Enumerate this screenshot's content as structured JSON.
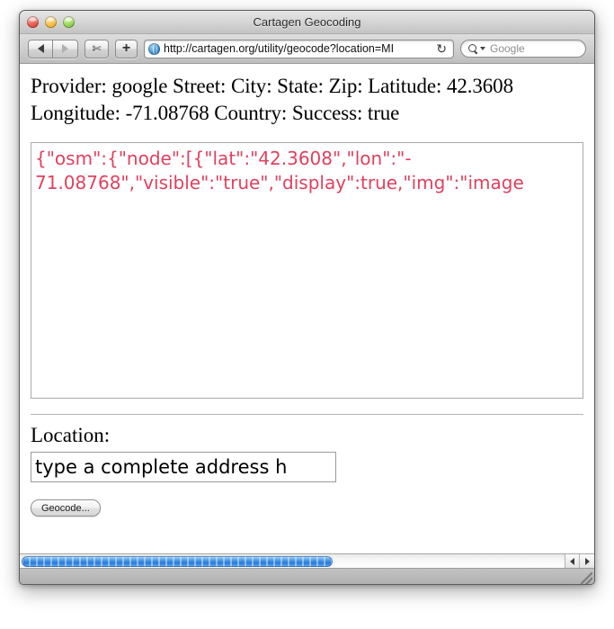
{
  "window": {
    "title": "Cartagen Geocoding",
    "controls": {
      "close": "close",
      "minimize": "minimize",
      "zoom": "zoom"
    }
  },
  "toolbar": {
    "back_label": "◀",
    "forward_label": "▶",
    "snip_label": "✂",
    "add_label": "+",
    "url": "http://cartagen.org/utility/geocode?location=MI",
    "reload_label": "↻",
    "search_placeholder": "Google"
  },
  "page": {
    "summary": "Provider: google Street: City: State: Zip: Latitude: 42.3608 Longitude: -71.08768 Country: Success: true",
    "json_output": "{\"osm\":{\"node\":[{\"lat\":\"42.3608\",\"lon\":\"-\n71.08768\",\"visible\":\"true\",\"display\":true,\"img\":\"image",
    "location_label": "Location:",
    "location_value": "type a complete address h",
    "location_placeholder": "type a complete address here",
    "geocode_button": "Geocode..."
  },
  "scrollbar": {
    "left_arrow": "◀",
    "right_arrow": "▶"
  },
  "colors": {
    "json_text": "#e0415e",
    "scroll_thumb": "#2a78d6",
    "title_text": "#2b2b2b"
  }
}
